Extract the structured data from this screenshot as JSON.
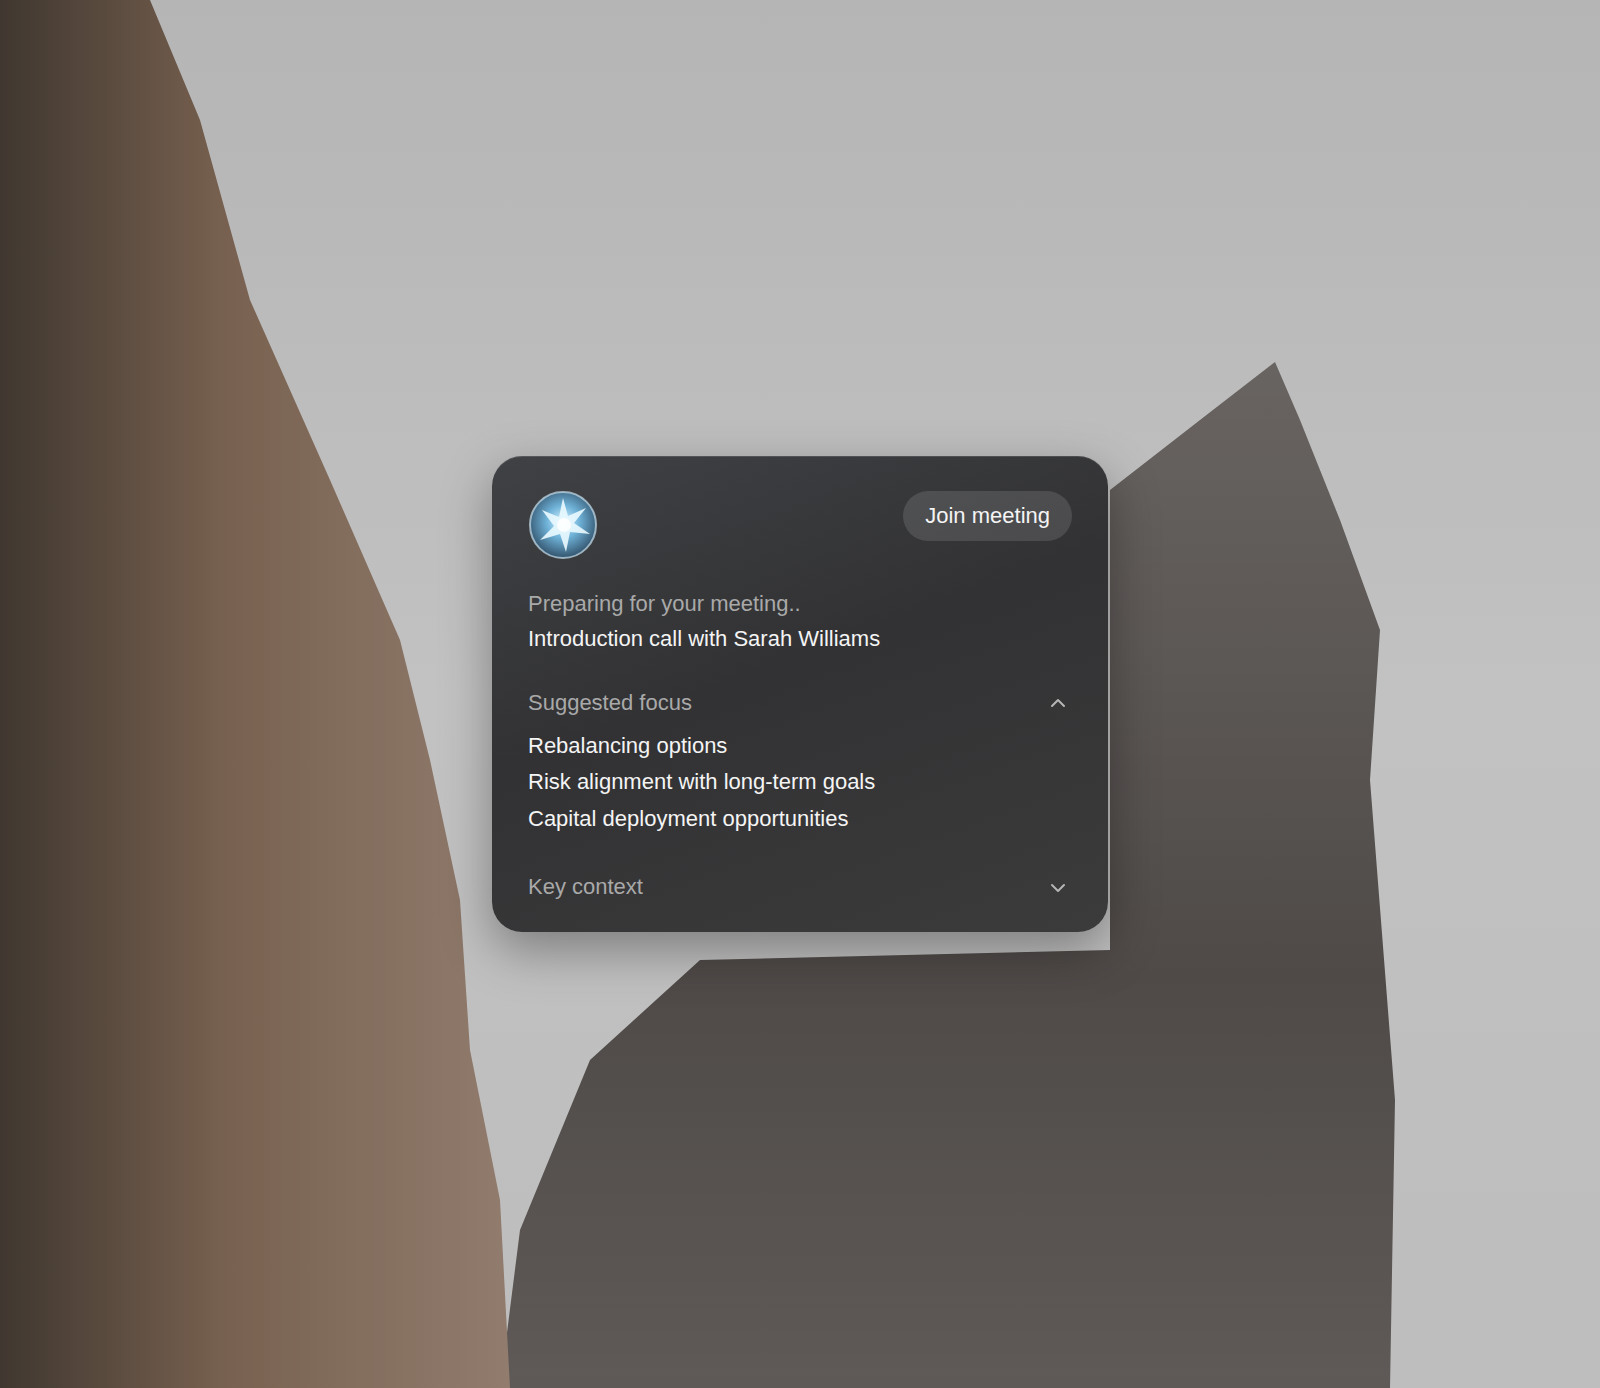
{
  "assistant": {
    "join_button": "Join meeting",
    "status": "Preparing for your meeting..",
    "meeting_title": "Introduction call with Sarah Williams"
  },
  "sections": [
    {
      "title": "Suggested focus",
      "expanded": true,
      "items": [
        "Rebalancing options",
        "Risk alignment with long-term goals",
        "Capital deployment opportunities"
      ]
    },
    {
      "title": "Key context",
      "expanded": false,
      "items": []
    }
  ]
}
